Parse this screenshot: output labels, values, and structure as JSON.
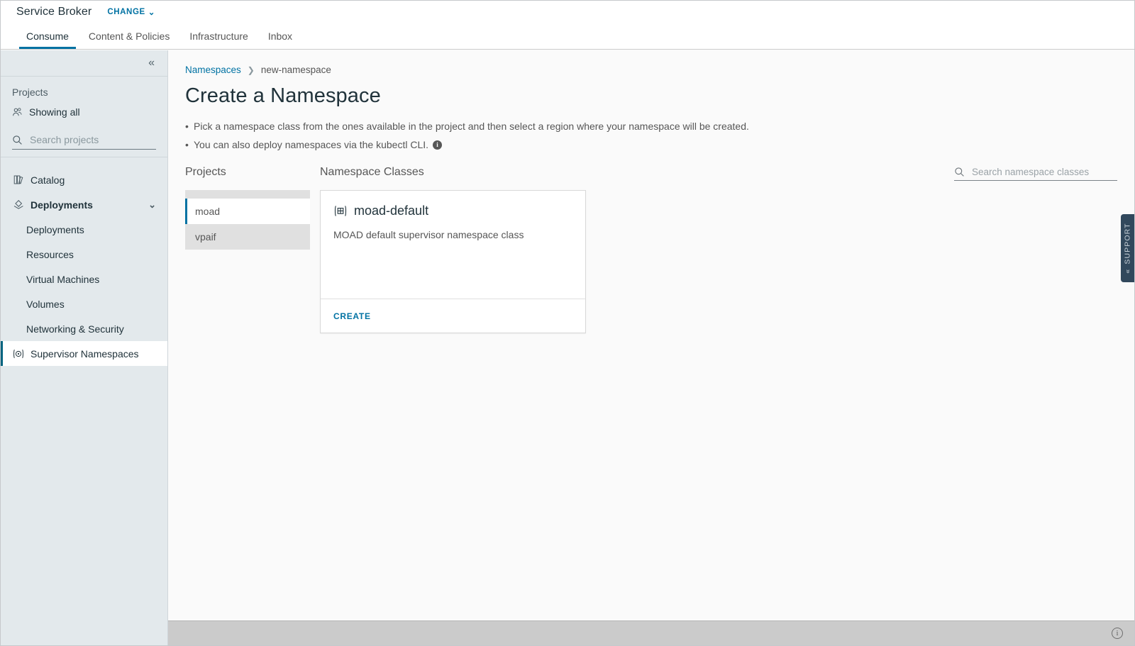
{
  "header": {
    "app_title": "Service Broker",
    "change_label": "CHANGE",
    "change_caret": "⌄"
  },
  "tabs": [
    {
      "label": "Consume",
      "active": true
    },
    {
      "label": "Content & Policies",
      "active": false
    },
    {
      "label": "Infrastructure",
      "active": false
    },
    {
      "label": "Inbox",
      "active": false
    }
  ],
  "sidebar": {
    "collapse_icon": "«",
    "projects_label": "Projects",
    "showing_all_label": "Showing all",
    "search_placeholder": "Search projects",
    "search_value": "",
    "nav": [
      {
        "label": "Catalog",
        "icon": "catalog-icon",
        "type": "top",
        "selected": false
      },
      {
        "label": "Deployments",
        "icon": "deployments-icon",
        "type": "group",
        "selected": false,
        "caret": "⌄"
      },
      {
        "label": "Deployments",
        "icon": "",
        "type": "sub",
        "selected": false
      },
      {
        "label": "Resources",
        "icon": "",
        "type": "sub",
        "selected": false
      },
      {
        "label": "Virtual Machines",
        "icon": "",
        "type": "sub",
        "selected": false
      },
      {
        "label": "Volumes",
        "icon": "",
        "type": "sub",
        "selected": false
      },
      {
        "label": "Networking & Security",
        "icon": "",
        "type": "sub",
        "selected": false
      },
      {
        "label": "Supervisor Namespaces",
        "icon": "supervisor-namespaces-icon",
        "type": "top",
        "selected": true
      }
    ]
  },
  "breadcrumb": {
    "root_label": "Namespaces",
    "separator": "❯",
    "current_label": "new-namespace"
  },
  "page": {
    "title": "Create a Namespace",
    "hints": [
      "Pick a namespace class from the ones available in the project and then select a region where your namespace will be created.",
      "You can also deploy namespaces via the kubectl CLI."
    ],
    "hint_info_glyph": "i"
  },
  "projects_panel": {
    "heading": "Projects",
    "items": [
      {
        "label": "moad",
        "selected": true
      },
      {
        "label": "vpaif",
        "selected": false
      }
    ]
  },
  "classes_panel": {
    "heading": "Namespace Classes",
    "search_placeholder": "Search namespace classes",
    "search_value": "",
    "cards": [
      {
        "icon": "namespace-class-icon",
        "title": "moad-default",
        "description": "MOAD default supervisor namespace class",
        "action_label": "CREATE"
      }
    ]
  },
  "support": {
    "label": "SUPPORT",
    "chevron": "«"
  },
  "footer": {
    "info_glyph": "i"
  },
  "colors": {
    "accent": "#0072a3",
    "sidebar_bg": "#e3e9ec",
    "selected_border": "#00637f",
    "support_bg": "#31485c",
    "footer_bg": "#cbcbcb"
  }
}
